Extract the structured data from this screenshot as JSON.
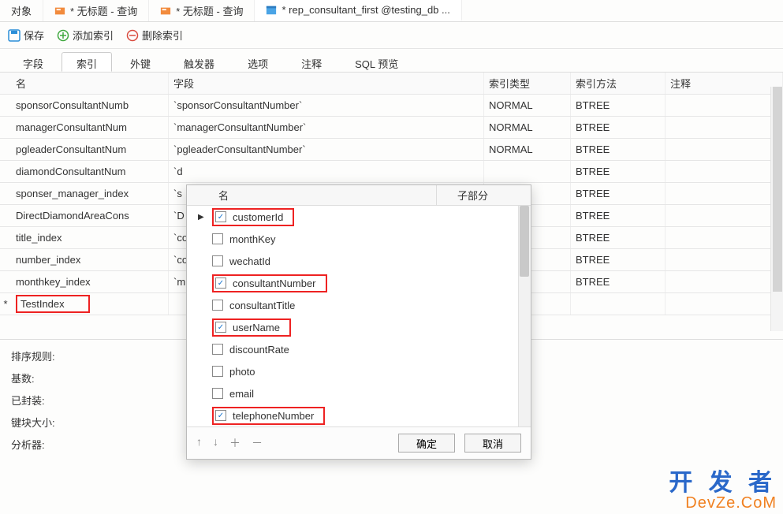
{
  "tabs": {
    "objects": "对象",
    "untitled1": "* 无标题 - 查询",
    "untitled2": "* 无标题 - 查询",
    "active": "* rep_consultant_first @testing_db ..."
  },
  "toolbar": {
    "save": "保存",
    "add_index": "添加索引",
    "del_index": "删除索引"
  },
  "subtabs": {
    "fields": "字段",
    "indexes": "索引",
    "fk": "外键",
    "triggers": "触发器",
    "options": "选项",
    "comments": "注释",
    "sql": "SQL 预览"
  },
  "grid": {
    "hdr_name": "名",
    "hdr_field": "字段",
    "hdr_type": "索引类型",
    "hdr_method": "索引方法",
    "hdr_note": "注释",
    "rows": [
      {
        "name": "sponsorConsultantNumb",
        "field": "`sponsorConsultantNumber`",
        "type": "NORMAL",
        "method": "BTREE"
      },
      {
        "name": "managerConsultantNum",
        "field": "`managerConsultantNumber`",
        "type": "NORMAL",
        "method": "BTREE"
      },
      {
        "name": "pgleaderConsultantNum",
        "field": "`pgleaderConsultantNumber`",
        "type": "NORMAL",
        "method": "BTREE"
      },
      {
        "name": "diamondConsultantNum",
        "field": "`d",
        "type": "",
        "method": "BTREE"
      },
      {
        "name": "sponser_manager_index",
        "field": "`s",
        "type": "",
        "method": "BTREE"
      },
      {
        "name": "DirectDiamondAreaCons",
        "field": "`D",
        "type": "",
        "method": "BTREE"
      },
      {
        "name": "title_index",
        "field": "`co",
        "type": "",
        "method": "BTREE"
      },
      {
        "name": "number_index",
        "field": "`co",
        "type": "",
        "method": "BTREE"
      },
      {
        "name": "monthkey_index",
        "field": "`m",
        "type": "",
        "method": "BTREE"
      },
      {
        "name": "TestIndex",
        "field": "",
        "type": "",
        "method": ""
      }
    ]
  },
  "popup": {
    "hdr_name": "名",
    "hdr_sub": "子部分",
    "items": [
      {
        "label": "customerId",
        "checked": true,
        "marker": true,
        "hl": true
      },
      {
        "label": "monthKey",
        "checked": false,
        "hl": false
      },
      {
        "label": "wechatId",
        "checked": false,
        "hl": false
      },
      {
        "label": "consultantNumber",
        "checked": true,
        "hl": true
      },
      {
        "label": "consultantTitle",
        "checked": false,
        "hl": false
      },
      {
        "label": "userName",
        "checked": true,
        "hl": true
      },
      {
        "label": "discountRate",
        "checked": false,
        "hl": false
      },
      {
        "label": "photo",
        "checked": false,
        "hl": false
      },
      {
        "label": "email",
        "checked": false,
        "hl": false
      },
      {
        "label": "telephoneNumber",
        "checked": true,
        "hl": true
      }
    ],
    "ok": "确定",
    "cancel": "取消"
  },
  "props": {
    "sort": "排序规则:",
    "card": "基数:",
    "packed": "已封装:",
    "blocksize": "键块大小:",
    "analyzer": "分析器:"
  },
  "watermark": {
    "cn": "开 发 者",
    "en": "DevZe.CoM"
  }
}
